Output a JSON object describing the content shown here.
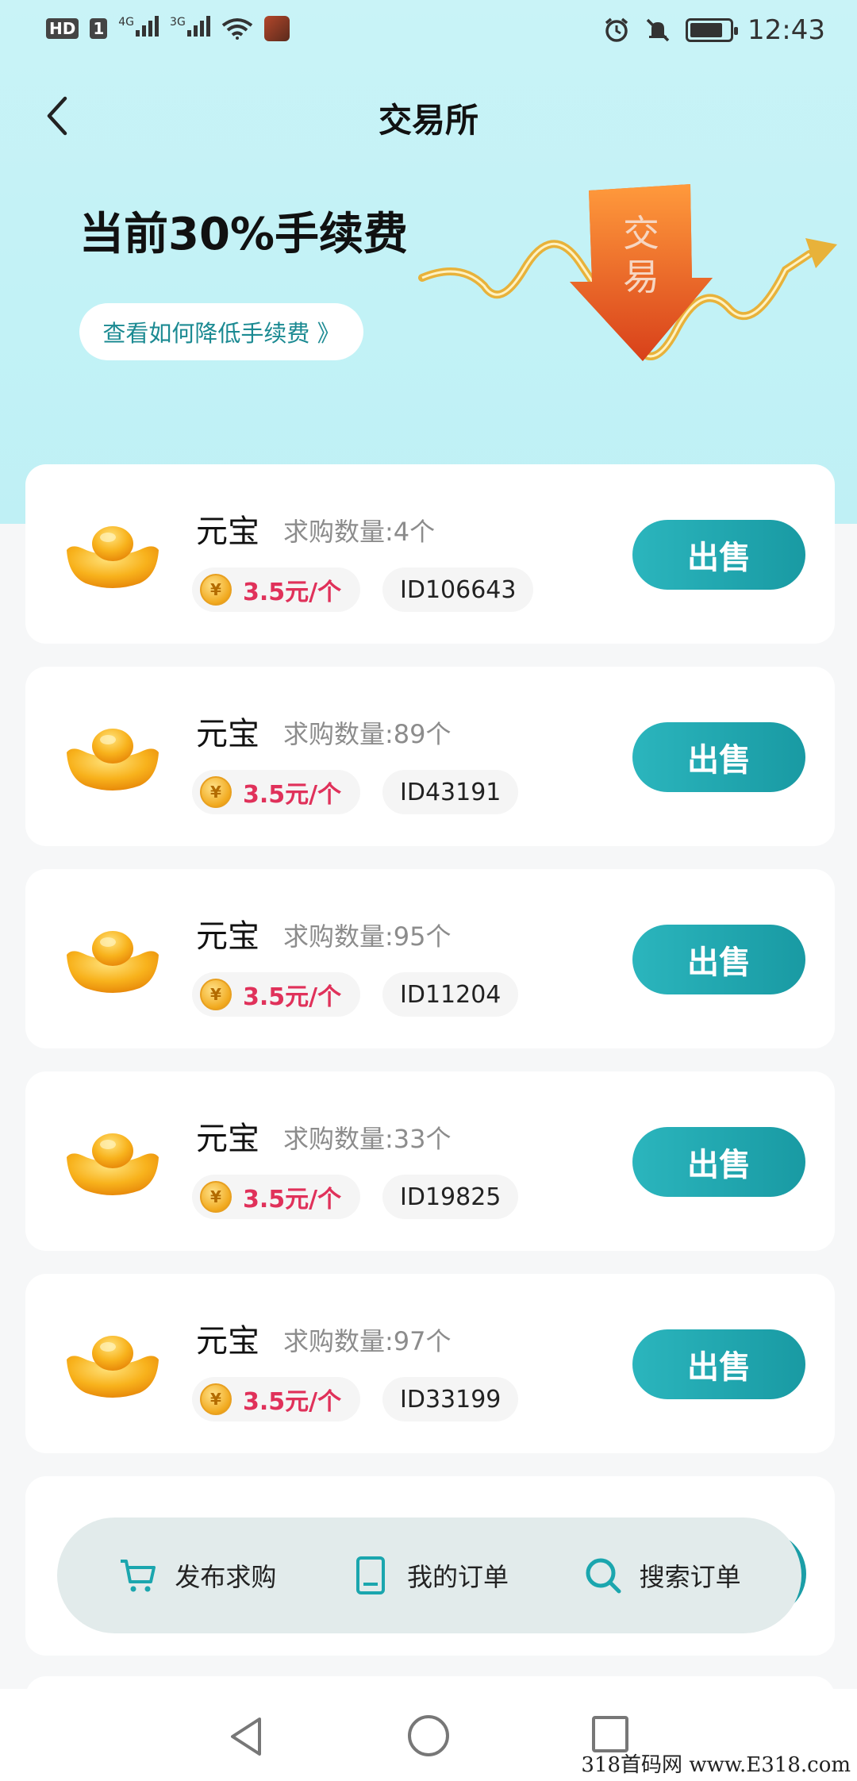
{
  "status_bar": {
    "hd": "HD",
    "sim1": "1",
    "net1": "4G",
    "net2": "3G",
    "time": "12:43"
  },
  "header": {
    "title": "交易所"
  },
  "banner": {
    "fee_text": "当前30%手续费",
    "link_text": "查看如何降低手续费 》",
    "art_text_1": "交",
    "art_text_2": "易"
  },
  "colors": {
    "accent": "#1b9ea7",
    "price": "#e0315a",
    "hero_bg": "#c2f2f6"
  },
  "orders": [
    {
      "name": "元宝",
      "qty": "求购数量:4个",
      "price": "3.5元/个",
      "id": "ID106643",
      "action": "出售"
    },
    {
      "name": "元宝",
      "qty": "求购数量:89个",
      "price": "3.5元/个",
      "id": "ID43191",
      "action": "出售"
    },
    {
      "name": "元宝",
      "qty": "求购数量:95个",
      "price": "3.5元/个",
      "id": "ID11204",
      "action": "出售"
    },
    {
      "name": "元宝",
      "qty": "求购数量:33个",
      "price": "3.5元/个",
      "id": "ID19825",
      "action": "出售"
    },
    {
      "name": "元宝",
      "qty": "求购数量:97个",
      "price": "3.5元/个",
      "id": "ID33199",
      "action": "出售"
    }
  ],
  "coin_glyph": "¥",
  "actions": {
    "publish": "发布求购",
    "my_orders": "我的订单",
    "search": "搜索订单"
  },
  "watermark": "318首码网 www.E318.com"
}
